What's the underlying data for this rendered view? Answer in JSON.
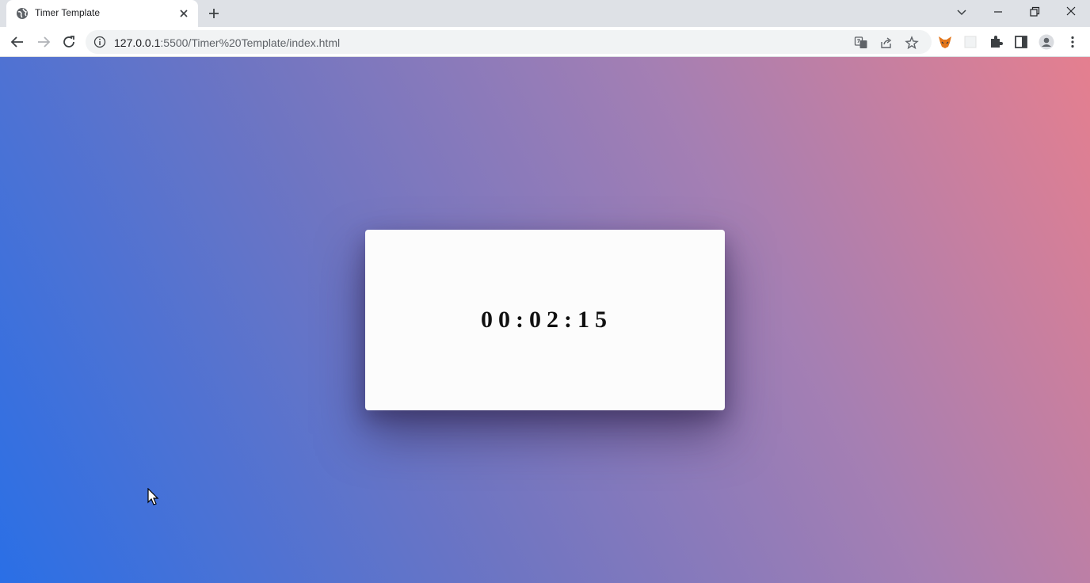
{
  "browser": {
    "tab": {
      "title": "Timer Template"
    },
    "address": {
      "host": "127.0.0.1",
      "path": ":5500/Timer%20Template/index.html"
    }
  },
  "page": {
    "timer": {
      "display": "00:02:15"
    }
  },
  "colors": {
    "gradient_start": "#2a6fe6",
    "gradient_mid": "#a57fb3",
    "gradient_end": "#e57f8f",
    "card": "#fcfcfc"
  }
}
